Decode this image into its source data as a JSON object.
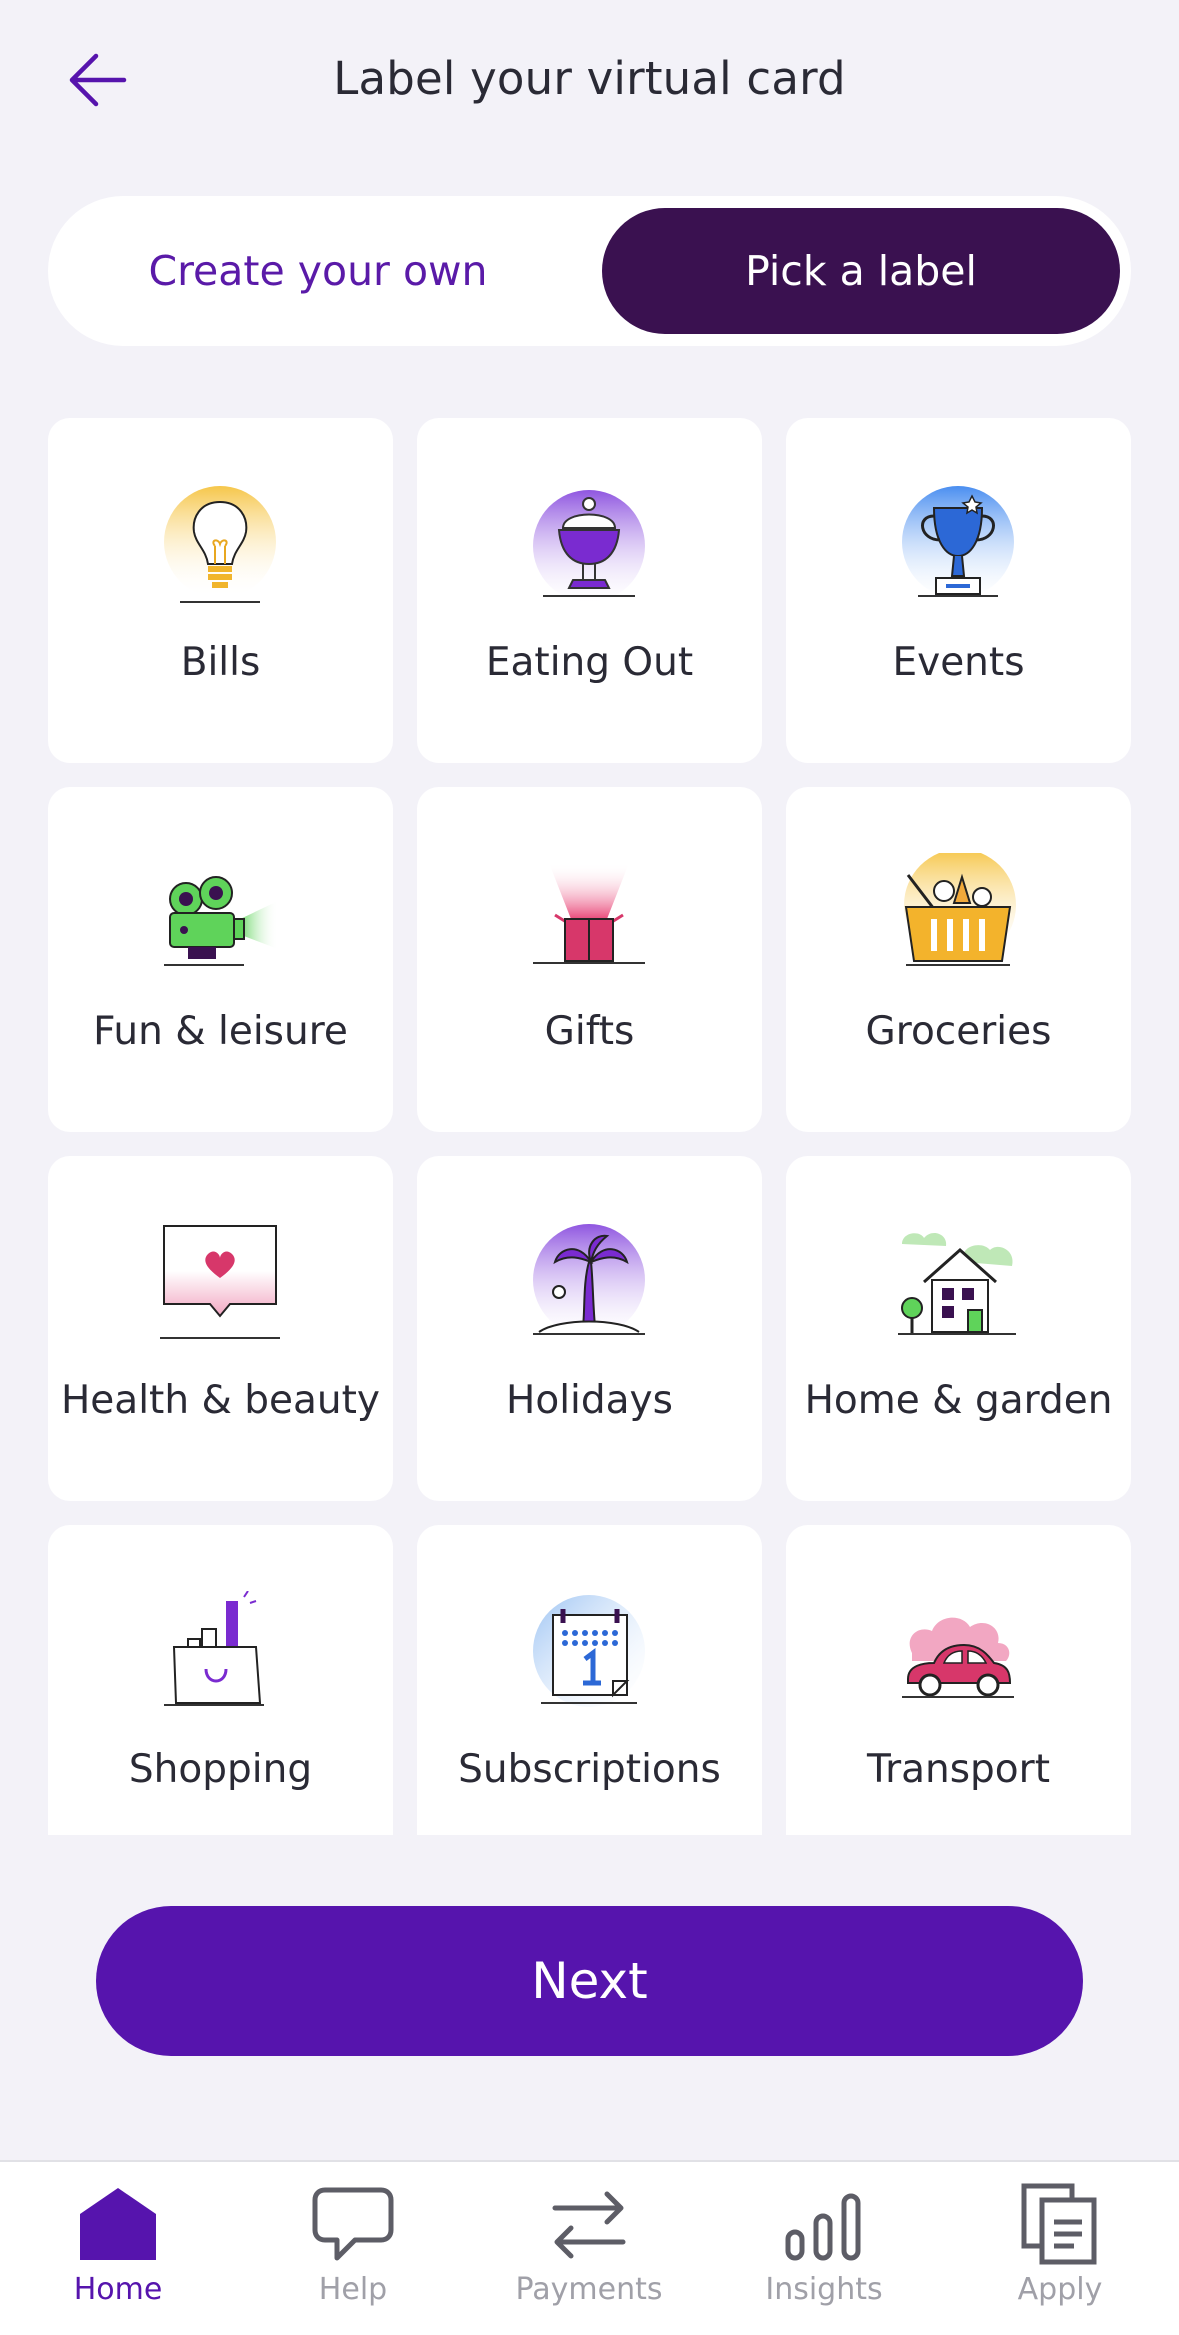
{
  "header": {
    "title": "Label your virtual card"
  },
  "segmented": {
    "create_label": "Create your own",
    "pick_label": "Pick a label"
  },
  "labels": [
    {
      "name": "Bills"
    },
    {
      "name": "Eating Out"
    },
    {
      "name": "Events"
    },
    {
      "name": "Fun & leisure"
    },
    {
      "name": "Gifts"
    },
    {
      "name": "Groceries"
    },
    {
      "name": "Health & beauty"
    },
    {
      "name": "Holidays"
    },
    {
      "name": "Home & garden"
    },
    {
      "name": "Shopping"
    },
    {
      "name": "Subscriptions"
    },
    {
      "name": "Transport"
    }
  ],
  "next_button": "Next",
  "tabbar": {
    "items": [
      {
        "label": "Home",
        "icon": "home-icon",
        "active": true
      },
      {
        "label": "Help",
        "icon": "chat-bubble-icon",
        "active": false
      },
      {
        "label": "Payments",
        "icon": "transfer-arrows-icon",
        "active": false
      },
      {
        "label": "Insights",
        "icon": "bar-chart-icon",
        "active": false
      },
      {
        "label": "Apply",
        "icon": "documents-icon",
        "active": false
      }
    ]
  },
  "colors": {
    "background": "#f3f2f8",
    "accent": "#5614ad",
    "segment_active": "#3a1150",
    "text": "#2a2a35",
    "tab_inactive": "#a0a0a8"
  }
}
